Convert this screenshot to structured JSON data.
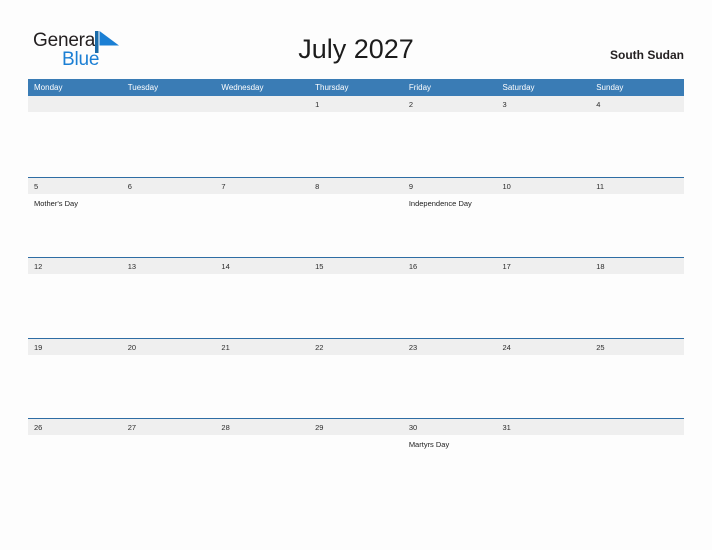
{
  "brand": {
    "name_part1": "General",
    "name_part2": "Blue",
    "mark_icon": "blue-flag-triangle-icon",
    "colors": {
      "general_text": "#231f20",
      "blue_text": "#1b7fd4",
      "mark": "#1b7fd4"
    }
  },
  "header": {
    "title": "July 2027",
    "region": "South Sudan"
  },
  "theme": {
    "header_row_bg": "#3a7cb5",
    "header_row_text": "#ffffff",
    "date_band_bg": "#efefef",
    "row_divider": "#2e6da4",
    "page_bg": "#fdfdfd",
    "date_text": "#2b2b2b",
    "event_text": "#1d1d1d"
  },
  "calendar": {
    "month": "July",
    "year": "2027",
    "weekday_headers": [
      "Monday",
      "Tuesday",
      "Wednesday",
      "Thursday",
      "Friday",
      "Saturday",
      "Sunday"
    ],
    "weeks": [
      {
        "days": [
          {
            "date": "",
            "events": []
          },
          {
            "date": "",
            "events": []
          },
          {
            "date": "",
            "events": []
          },
          {
            "date": "1",
            "events": []
          },
          {
            "date": "2",
            "events": []
          },
          {
            "date": "3",
            "events": []
          },
          {
            "date": "4",
            "events": []
          }
        ]
      },
      {
        "days": [
          {
            "date": "5",
            "events": [
              "Mother's Day"
            ]
          },
          {
            "date": "6",
            "events": []
          },
          {
            "date": "7",
            "events": []
          },
          {
            "date": "8",
            "events": []
          },
          {
            "date": "9",
            "events": [
              "Independence Day"
            ]
          },
          {
            "date": "10",
            "events": []
          },
          {
            "date": "11",
            "events": []
          }
        ]
      },
      {
        "days": [
          {
            "date": "12",
            "events": []
          },
          {
            "date": "13",
            "events": []
          },
          {
            "date": "14",
            "events": []
          },
          {
            "date": "15",
            "events": []
          },
          {
            "date": "16",
            "events": []
          },
          {
            "date": "17",
            "events": []
          },
          {
            "date": "18",
            "events": []
          }
        ]
      },
      {
        "days": [
          {
            "date": "19",
            "events": []
          },
          {
            "date": "20",
            "events": []
          },
          {
            "date": "21",
            "events": []
          },
          {
            "date": "22",
            "events": []
          },
          {
            "date": "23",
            "events": []
          },
          {
            "date": "24",
            "events": []
          },
          {
            "date": "25",
            "events": []
          }
        ]
      },
      {
        "days": [
          {
            "date": "26",
            "events": []
          },
          {
            "date": "27",
            "events": []
          },
          {
            "date": "28",
            "events": []
          },
          {
            "date": "29",
            "events": []
          },
          {
            "date": "30",
            "events": [
              "Martyrs Day"
            ]
          },
          {
            "date": "31",
            "events": []
          },
          {
            "date": "",
            "events": []
          }
        ]
      }
    ]
  }
}
